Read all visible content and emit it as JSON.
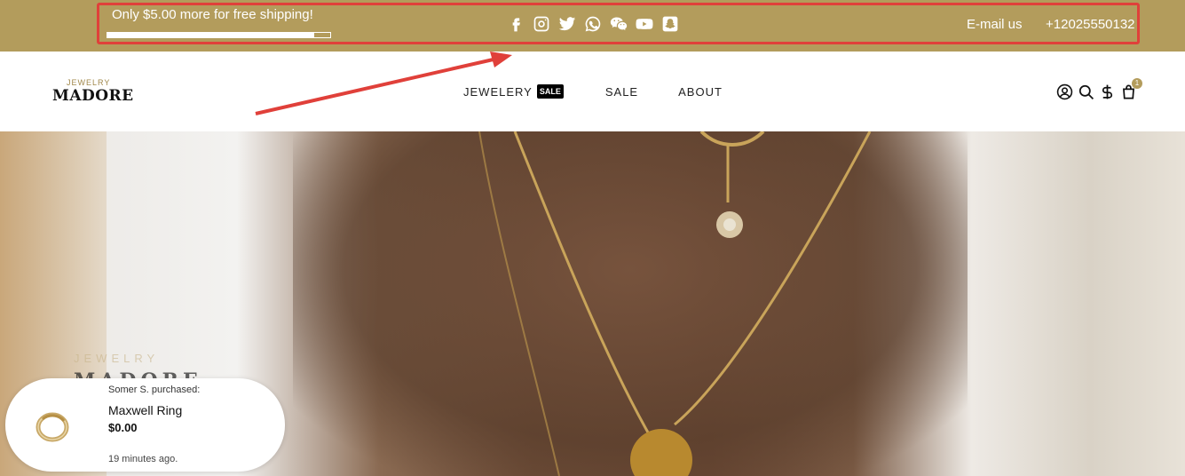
{
  "announcement": {
    "shipping_text": "Only $5.00 more for free shipping!",
    "shipping_progress_percent": 93,
    "social_icons": [
      "facebook-icon",
      "instagram-icon",
      "twitter-icon",
      "whatsapp-icon",
      "wechat-icon",
      "youtube-icon",
      "snapchat-icon"
    ],
    "email_label": "E-mail us",
    "phone_label": "+12025550132"
  },
  "header": {
    "logo_small": "JEWELRY",
    "logo_big": "MADORE",
    "nav": [
      {
        "label": "JEWELERY",
        "badge": "SALE"
      },
      {
        "label": "SALE"
      },
      {
        "label": "ABOUT"
      }
    ],
    "icons": [
      "account-icon",
      "search-icon",
      "currency-icon",
      "cart-icon"
    ],
    "cart_count": "1"
  },
  "hero": {
    "overlay_small": "JEWELRY",
    "overlay_big": "MADORE"
  },
  "toast": {
    "who": "Somer S. purchased:",
    "product": "Maxwell Ring",
    "price": "$0.00",
    "time": "19 minutes ago."
  },
  "colors": {
    "brand_gold": "#b39c5c",
    "annotation_red": "#e0403a"
  }
}
